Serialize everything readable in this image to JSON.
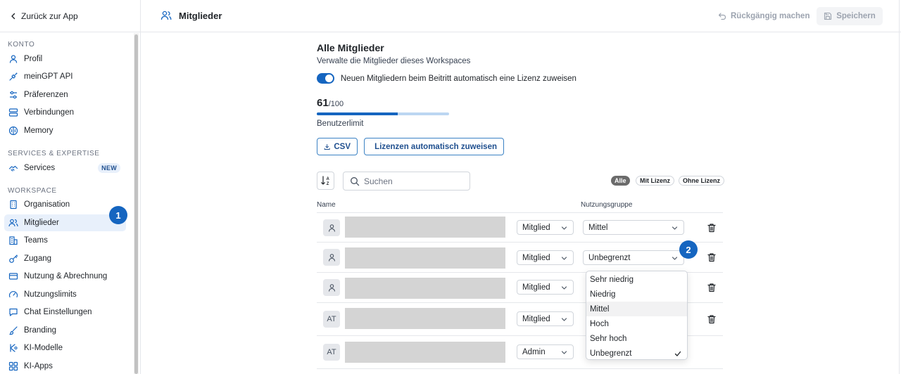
{
  "sidebar": {
    "back_label": "Zurück zur App",
    "sections": {
      "konto": "KONTO",
      "services": "SERVICES & EXPERTISE",
      "workspace": "WORKSPACE"
    },
    "items": {
      "profil": "Profil",
      "api": "meinGPT API",
      "praeferenzen": "Präferenzen",
      "verbindungen": "Verbindungen",
      "memory": "Memory",
      "services": "Services",
      "services_badge": "NEW",
      "organisation": "Organisation",
      "mitglieder": "Mitglieder",
      "teams": "Teams",
      "zugang": "Zugang",
      "nutzung": "Nutzung & Abrechnung",
      "limits": "Nutzungslimits",
      "chat": "Chat Einstellungen",
      "branding": "Branding",
      "modelle": "KI-Modelle",
      "apps": "KI-Apps"
    }
  },
  "header": {
    "title": "Mitglieder",
    "undo_label": "Rückgängig machen",
    "save_label": "Speichern"
  },
  "main": {
    "title": "Alle Mitglieder",
    "subtitle": "Verwalte die Mitglieder dieses Workspaces",
    "auto_license_label": "Neuen Mitgliedern beim Beitritt automatisch eine Lizenz zuweisen",
    "auto_license_enabled": true,
    "user_count": "61",
    "user_limit_text": "/100",
    "usage_fraction": 0.61,
    "user_limit_label": "Benutzerlimit",
    "csv_label": "CSV",
    "auto_assign_label": "Lizenzen automatisch zuweisen",
    "search_placeholder": "Suchen",
    "filters": [
      "Alle",
      "Mit Lizenz",
      "Ohne Lizenz"
    ],
    "active_filter": "Alle",
    "columns": {
      "name": "Name",
      "group": "Nutzungsgruppe"
    },
    "rows": [
      {
        "avatar": "",
        "role": "Mitglied",
        "group": "Mittel"
      },
      {
        "avatar": "",
        "role": "Mitglied",
        "group": "Unbegrenzt"
      },
      {
        "avatar": "",
        "role": "Mitglied",
        "group": ""
      },
      {
        "avatar": "AT",
        "role": "Mitglied",
        "group": ""
      },
      {
        "avatar": "AT",
        "role": "Admin",
        "group": ""
      }
    ]
  },
  "dropdown": {
    "options": [
      "Sehr niedrig",
      "Niedrig",
      "Mittel",
      "Hoch",
      "Sehr hoch",
      "Unbegrenzt"
    ],
    "highlighted": "Mittel",
    "selected": "Unbegrenzt"
  },
  "markers": [
    "1",
    "2"
  ],
  "colors": {
    "accent": "#1565c0",
    "active_nav_bg": "#e8f0fb",
    "redacted": "#d4d4d4"
  }
}
